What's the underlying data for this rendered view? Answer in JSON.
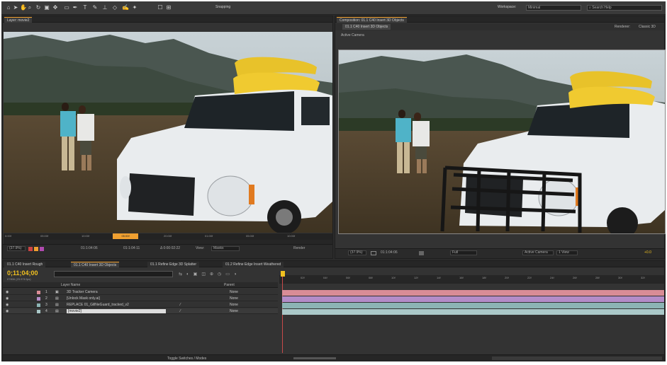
{
  "toolbar": {
    "tools": [
      "select-tool",
      "hand-tool",
      "zoom-tool",
      "rotate-tool",
      "camera-tool",
      "pan-tool",
      "mask-tool",
      "pen-tool",
      "text-tool",
      "brush-tool",
      "stamp-tool",
      "eraser-tool",
      "roto-tool",
      "puppet-tool"
    ],
    "snapping": "Snapping",
    "workspace_label": "Workspace:",
    "workspace_value": "Minimal",
    "search_placeholder": "Search Help"
  },
  "layer_panel": {
    "tab": "Layer: movie2",
    "timecodes": [
      "0:00f",
      "05:00f",
      "10:00f",
      "15:00f",
      "20:00f",
      "01:00f",
      "05:00f",
      "10:00f",
      "15:00f"
    ],
    "current_time": "05:00f",
    "controls": {
      "zoom": "(37.9%)",
      "tc1": "01:1:04:06",
      "tc2": "01:1:04:11",
      "tc3": "Δ 0:00:02:22",
      "view_label": "View:",
      "view_value": "Masks",
      "render": "Render"
    }
  },
  "comp_panel": {
    "tab": "Composition: 01.1 C40 Insert 3D Objects",
    "subtab": "01.1 C40 Insert 3D Objects",
    "renderer_label": "Renderer:",
    "renderer_value": "Classic 3D",
    "active_camera": "Active Camera",
    "controls": {
      "zoom": "(37.9%)",
      "tc": "01:1:04:06",
      "resolution": "Full",
      "camera": "Active Camera",
      "views": "1 View",
      "exposure": "+0.0"
    }
  },
  "timeline": {
    "tabs": [
      "01.1 C40 Insert Rough",
      "01.1 C40 Insert 3D Objects",
      "01.1 Refine Edge 3D Splatter",
      "01.2 Refine Edge Insert Weathered"
    ],
    "active_tab": 1,
    "timecode": "0;11;04;00",
    "fps": "07806 (23.976 fps)",
    "search_placeholder": "",
    "col_layer_name": "Layer Name",
    "col_parent": "Parent",
    "layers": [
      {
        "num": "1",
        "name": "3D Tracker Camera",
        "parent": "None",
        "color": "#d98c96"
      },
      {
        "num": "2",
        "name": "[Unlock Mask only.ai]",
        "parent": "None",
        "color": "#b48cc8"
      },
      {
        "num": "3",
        "name": "REPLACE 01_GillNeGuard_tracked_v2",
        "parent": "None",
        "color": "#8cb4b4"
      },
      {
        "num": "4",
        "name": "[movie2]",
        "parent": "None",
        "color": "#aac8c8"
      }
    ],
    "ruler": [
      "0f",
      "02f",
      "04f",
      "06f",
      "08f",
      "10f",
      "12f",
      "14f",
      "16f",
      "18f",
      "20f",
      "22f",
      "24f",
      "26f",
      "28f",
      "30f",
      "32f",
      "34f"
    ],
    "footer": "Toggle Switches / Modes"
  },
  "colors": {
    "accent": "#f0a030",
    "timecode": "#f0c020",
    "panel_bg": "#333333"
  }
}
